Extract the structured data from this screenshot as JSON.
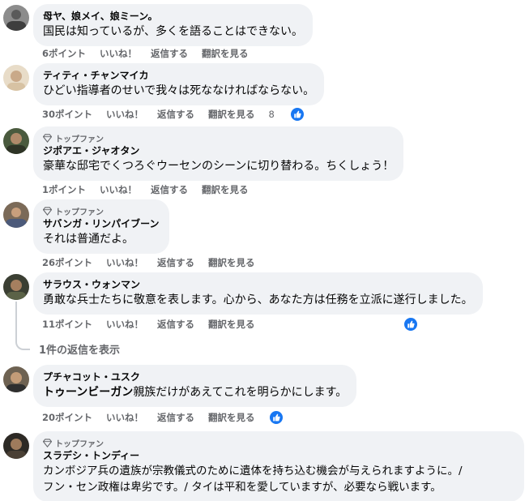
{
  "comments": [
    {
      "name": "母ヤ、娘メイ、娘ミーン。",
      "text": "国民は知っているが、多くを語ることはできない。",
      "points": "6ポイント",
      "like": "いいね！",
      "reply": "返信する",
      "translate": "翻訳を見る"
    },
    {
      "name": "ティティ・チャンマイカ",
      "text": "ひどい指導者のせいで我々は死ななければならない。",
      "points": "30ポイント",
      "like": "いいね！",
      "reply": "返信する",
      "translate": "翻訳を見る",
      "reaction_count": "8"
    },
    {
      "badge": "トップファン",
      "name": "ジポアエ・ジャオタン",
      "text": "豪華な邸宅でくつろぐウーセンのシーンに切り替わる。ちくしょう！",
      "points": "1ポイント",
      "like": "いいね！",
      "reply": "返信する",
      "translate": "翻訳を見る"
    },
    {
      "badge": "トップファン",
      "name": "サバンガ・リンパイブーン",
      "text": "それは普通だよ。",
      "points": "26ポイント",
      "like": "いいね！",
      "reply": "返信する",
      "translate": "翻訳を見る"
    },
    {
      "name": "サラウス・ウォンマン",
      "text": "勇敢な兵士たちに敬意を表します。心から、あなた方は任務を立派に遂行しました。",
      "points": "11ポイント",
      "like": "いいね！",
      "reply": "返信する",
      "translate": "翻訳を見る",
      "view_replies": "1件の返信を表示"
    },
    {
      "name": "プチャコット・ユスク",
      "text_bold": "トゥーンビーガン",
      "text": "親族だけがあえてこれを明らかにします。",
      "points": "20ポイント",
      "like": "いいね！",
      "reply": "返信する",
      "translate": "翻訳を見る"
    },
    {
      "badge": "トップファン",
      "name": "スラデシ・トンディー",
      "text_line1": "カンボジア兵の遺族が宗教儀式のために遺体を持ち込む機会が与えられますように。/",
      "text_line2": "フン・セン政権は卑劣です。/ タイは平和を愛していますが、必要なら戦います。"
    }
  ],
  "colors": {
    "bubble": "#f0f2f5",
    "meta": "#65676b",
    "like_blue": "#1877f2"
  }
}
